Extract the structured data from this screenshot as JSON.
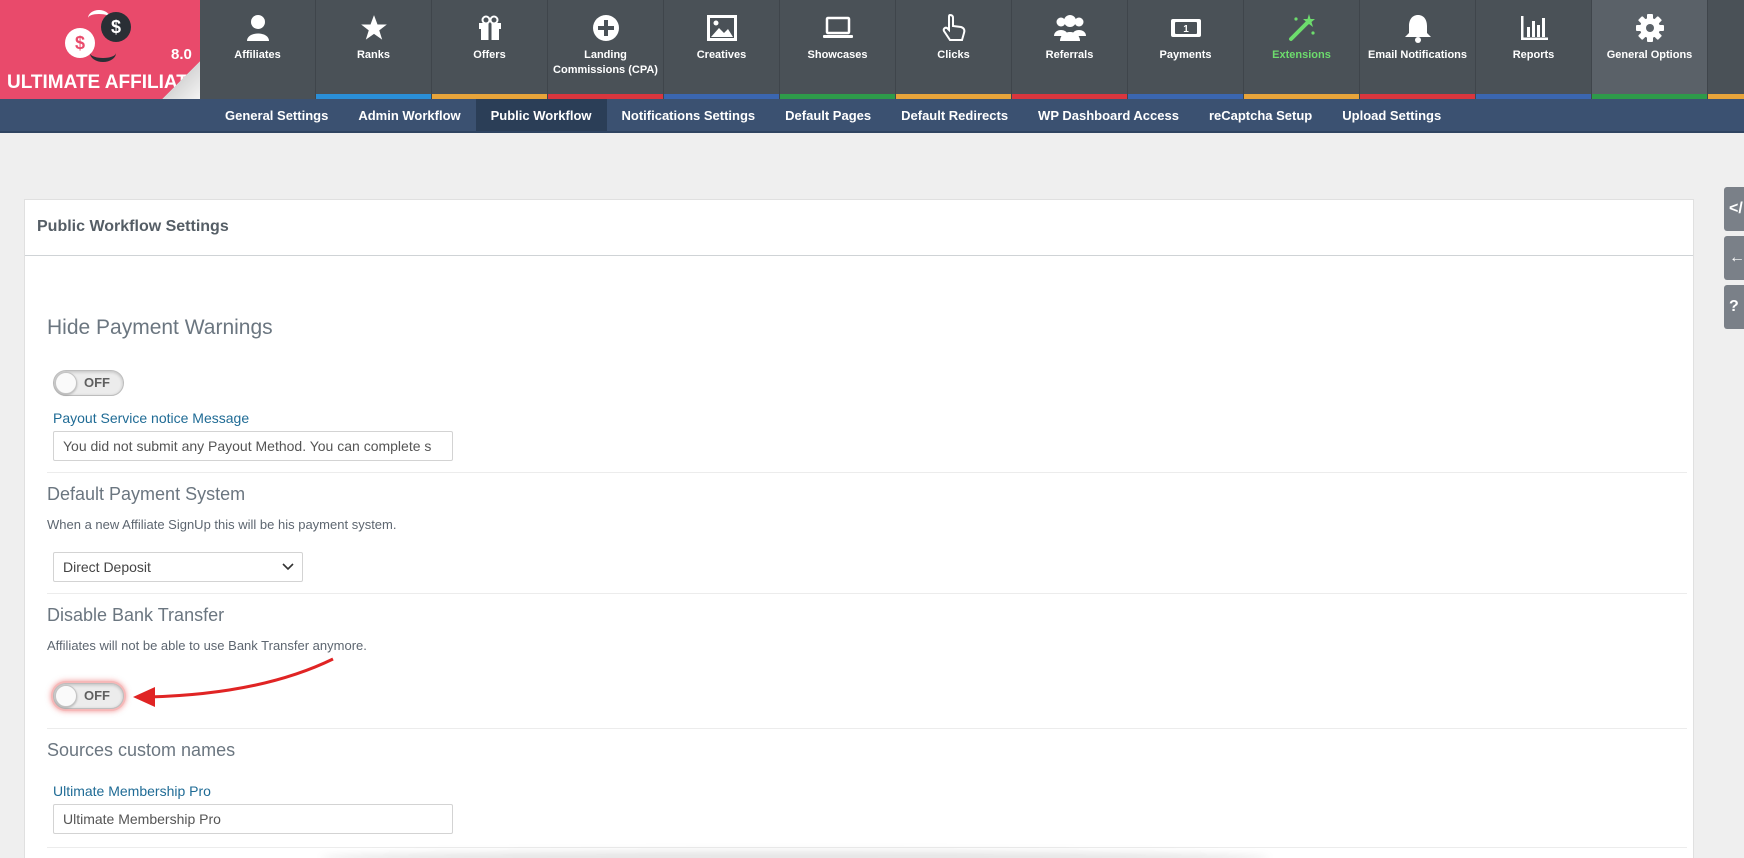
{
  "logo": {
    "version": "8.0",
    "name": "ULTIMATE AFFILIATE",
    "coin1": "$",
    "coin2": "$"
  },
  "nav": [
    {
      "label": "Affiliates",
      "icon": "user-icon",
      "color": "#4a5157"
    },
    {
      "label": "Ranks",
      "icon": "star-icon",
      "color": "#2a8fd8"
    },
    {
      "label": "Offers",
      "icon": "gift-icon",
      "color": "#e8a43a"
    },
    {
      "label": "Landing Commissions (CPA)",
      "icon": "plus-circle-icon",
      "color": "#d9363e"
    },
    {
      "label": "Creatives",
      "icon": "image-icon",
      "color": "#3b66b0"
    },
    {
      "label": "Showcases",
      "icon": "laptop-icon",
      "color": "#2e9a4a"
    },
    {
      "label": "Clicks",
      "icon": "pointer-icon",
      "color": "#e8a43a"
    },
    {
      "label": "Referrals",
      "icon": "users-icon",
      "color": "#d9363e"
    },
    {
      "label": "Payments",
      "icon": "money-icon",
      "color": "#3b66b0"
    },
    {
      "label": "Extensions",
      "icon": "magic-wand-icon",
      "color": "#e8a43a"
    },
    {
      "label": "Email Notifications",
      "icon": "bell-icon",
      "color": "#d9363e"
    },
    {
      "label": "Reports",
      "icon": "bar-chart-icon",
      "color": "#3b66b0"
    },
    {
      "label": "General Options",
      "icon": "gear-icon",
      "color": "#2e9a4a"
    }
  ],
  "subnav": [
    "General Settings",
    "Admin Workflow",
    "Public Workflow",
    "Notifications Settings",
    "Default Pages",
    "Default Redirects",
    "WP Dashboard Access",
    "reCaptcha Setup",
    "Upload Settings"
  ],
  "sidetabs": [
    "</",
    "←",
    "?"
  ],
  "panel": {
    "title": "Public Workflow Settings",
    "hide_payment": {
      "title": "Hide Payment Warnings",
      "toggle": "OFF",
      "notice_label": "Payout Service notice Message",
      "notice_value": "You did not submit any Payout Method. You can complete s"
    },
    "default_payment": {
      "title": "Default Payment System",
      "desc": "When a new Affiliate SignUp this will be his payment system.",
      "selected": "Direct Deposit"
    },
    "disable_bank": {
      "title": "Disable Bank Transfer",
      "desc": "Affiliates will not be able to use Bank Transfer anymore.",
      "toggle": "OFF"
    },
    "sources": {
      "title": "Sources custom names",
      "label": "Ultimate Membership Pro",
      "value": "Ultimate Membership Pro"
    }
  },
  "colors": {
    "accent_red": "#e02424",
    "logo_pink": "#e94a6b",
    "nav_bg": "#4a5157",
    "subnav_bg": "#3b5171"
  }
}
